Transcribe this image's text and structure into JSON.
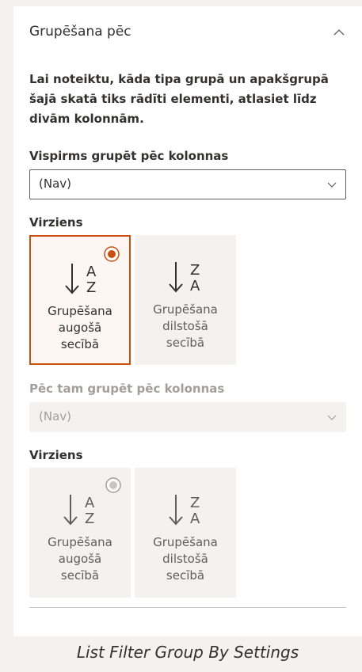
{
  "group_by": {
    "title": "Grupēšana pēc",
    "description": "Lai noteiktu, kāda tipa grupā un apakšgrupā šajā skatā tiks rādīti elementi, atlasiet līdz divām kolonnām.",
    "first": {
      "label": "Vispirms grupēt pēc kolonnas",
      "value": "(Nav)",
      "direction_label": "Virziens",
      "tiles": [
        {
          "label": "Grupēšana\naugošā\nsecībā",
          "top": "A",
          "bottom": "Z",
          "selected": true
        },
        {
          "label": "Grupēšana\ndilstošā\nsecībā",
          "top": "Z",
          "bottom": "A",
          "selected": false
        }
      ]
    },
    "second": {
      "label": "Pēc tam grupēt pēc kolonnas",
      "value": "(Nav)",
      "direction_label": "Virziens",
      "tiles": [
        {
          "label": "Grupēšana\naugošā\nsecībā",
          "top": "A",
          "bottom": "Z",
          "selected": false
        },
        {
          "label": "Grupēšana\ndilstošā\nsecībā",
          "top": "Z",
          "bottom": "A",
          "selected": false
        }
      ]
    }
  },
  "caption": "List Filter Group By Settings",
  "colors": {
    "accent": "#ca5010",
    "disabled": "#a19f9d",
    "tile_bg": "#f3f2f1"
  }
}
